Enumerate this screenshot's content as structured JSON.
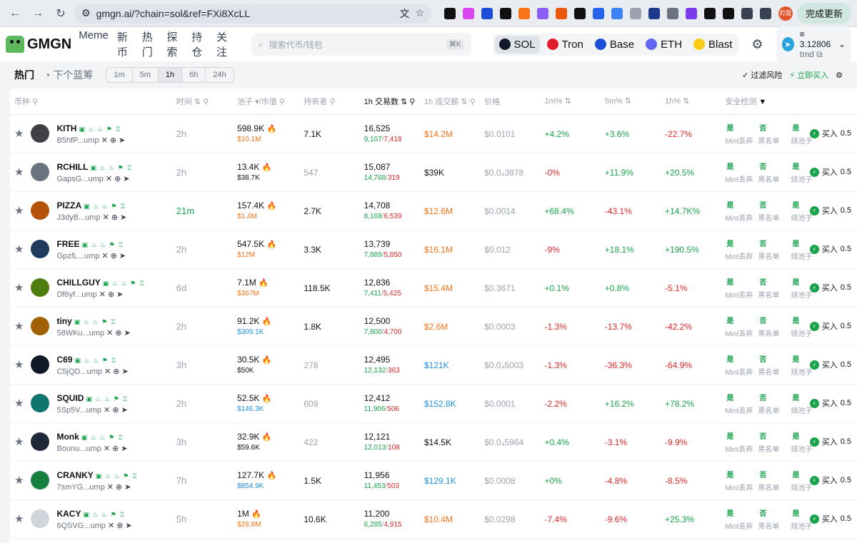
{
  "browser": {
    "url": "gmgn.ai/?chain=sol&ref=FXi8XcLL",
    "finish_update": "完成更新",
    "profile_badge": "盯盘"
  },
  "header": {
    "logo": "GMGN",
    "nav": [
      "Meme",
      "新币",
      "热门",
      "探索",
      "持仓",
      "关注"
    ],
    "search_placeholder": "搜索代币/钱包",
    "search_shortcut": "⌘K",
    "chains": [
      {
        "label": "SOL",
        "color": "#111827",
        "active": true
      },
      {
        "label": "Tron",
        "color": "#e11d2a",
        "active": false
      },
      {
        "label": "Base",
        "color": "#1d4ed8",
        "active": false
      },
      {
        "label": "ETH",
        "color": "#6366f1",
        "active": false
      },
      {
        "label": "Blast",
        "color": "#facc15",
        "active": false
      }
    ],
    "wallet_balance": "3.12806",
    "wallet_name": "tmd"
  },
  "filters": {
    "tab_hot": "热门",
    "tab_next": "下个蓝筹",
    "timeframes": [
      "1m",
      "5m",
      "1h",
      "6h",
      "24h"
    ],
    "active_timeframe": "1h",
    "filter_risk": "过滤风险",
    "buy_now": "立即买入"
  },
  "table": {
    "headers": {
      "coin": "币种",
      "time": "时间",
      "pool": "池子 ▾/市值",
      "holders": "持有者",
      "txs": "1h 交易数",
      "volume": "1h 成交额",
      "price": "价格",
      "m1": "1m%",
      "m5": "5m%",
      "h1": "1h%",
      "safety": "安全检测"
    },
    "safety_values": [
      "是",
      "否",
      "是"
    ],
    "safety_labels": [
      "Mint丢弃",
      "黑名单",
      "烧池子"
    ],
    "buy_label": "买入",
    "buy_amount": "0.5",
    "rows": [
      {
        "name": "KITH",
        "addr": "B5hfP...ump",
        "avatar": "#3f3f46",
        "time": "2h",
        "time_green": false,
        "pool": "598.9K",
        "mcap": "$10.1M",
        "mcap_color": "c-orange",
        "holders": "7.1K",
        "holders_grey": false,
        "txs": "16,525",
        "buys": "9,107",
        "sells": "7,418",
        "vol": "$14.2M",
        "vol_color": "c-orange",
        "price": "$0.0101",
        "m1": "+4.2%",
        "m5": "+3.6%",
        "h1": "-22.7%"
      },
      {
        "name": "RCHILL",
        "addr": "GapsG...ump",
        "avatar": "#6b7280",
        "time": "2h",
        "time_green": false,
        "pool": "13.4K",
        "mcap": "$38.7K",
        "mcap_color": "c-black",
        "holders": "547",
        "holders_grey": true,
        "txs": "15,087",
        "buys": "14,768",
        "sells": "319",
        "vol": "$39K",
        "vol_color": "c-black",
        "price": "$0.0₄3878",
        "m1": "-0%",
        "m5": "+11.9%",
        "h1": "+20.5%"
      },
      {
        "name": "PIZZA",
        "addr": "J3dyB...ump",
        "avatar": "#b45309",
        "time": "21m",
        "time_green": true,
        "pool": "157.4K",
        "mcap": "$1.4M",
        "mcap_color": "c-orange",
        "holders": "2.7K",
        "holders_grey": false,
        "txs": "14,708",
        "buys": "8,169",
        "sells": "6,539",
        "vol": "$12.6M",
        "vol_color": "c-orange",
        "price": "$0.0014",
        "m1": "+68.4%",
        "m5": "-43.1%",
        "h1": "+14.7K%"
      },
      {
        "name": "FREE",
        "addr": "GpzfL...ump",
        "avatar": "#1e3a5f",
        "time": "2h",
        "time_green": false,
        "pool": "547.5K",
        "mcap": "$12M",
        "mcap_color": "c-orange",
        "holders": "3.3K",
        "holders_grey": false,
        "txs": "13,739",
        "buys": "7,889",
        "sells": "5,850",
        "vol": "$16.1M",
        "vol_color": "c-orange",
        "price": "$0.012",
        "m1": "-9%",
        "m5": "+18.1%",
        "h1": "+190.5%"
      },
      {
        "name": "CHILLGUY",
        "addr": "Df6yf...ump",
        "avatar": "#4d7c0f",
        "time": "6d",
        "time_green": false,
        "pool": "7.1M",
        "mcap": "$367M",
        "mcap_color": "c-orange",
        "holders": "118.5K",
        "holders_grey": false,
        "txs": "12,836",
        "buys": "7,411",
        "sells": "5,425",
        "vol": "$15.4M",
        "vol_color": "c-orange",
        "price": "$0.3671",
        "m1": "+0.1%",
        "m5": "+0.8%",
        "h1": "-5.1%"
      },
      {
        "name": "tiny",
        "addr": "58WKu...ump",
        "avatar": "#a16207",
        "time": "2h",
        "time_green": false,
        "pool": "91.2K",
        "mcap": "$309.1K",
        "mcap_color": "c-blue",
        "holders": "1.8K",
        "holders_grey": false,
        "txs": "12,500",
        "buys": "7,800",
        "sells": "4,700",
        "vol": "$2.6M",
        "vol_color": "c-orange",
        "price": "$0.0003",
        "m1": "-1.3%",
        "m5": "-13.7%",
        "h1": "-42.2%"
      },
      {
        "name": "C69",
        "addr": "C5jQD...ump",
        "avatar": "#111827",
        "time": "3h",
        "time_green": false,
        "pool": "30.5K",
        "mcap": "$50K",
        "mcap_color": "c-black",
        "holders": "278",
        "holders_grey": true,
        "txs": "12,495",
        "buys": "12,132",
        "sells": "363",
        "vol": "$121K",
        "vol_color": "c-blue",
        "price": "$0.0₄5003",
        "m1": "-1.3%",
        "m5": "-36.3%",
        "h1": "-64.9%"
      },
      {
        "name": "SQUID",
        "addr": "5Sp5V...ump",
        "avatar": "#0f766e",
        "time": "2h",
        "time_green": false,
        "pool": "52.5K",
        "mcap": "$146.3K",
        "mcap_color": "c-blue",
        "holders": "609",
        "holders_grey": true,
        "txs": "12,412",
        "buys": "11,906",
        "sells": "506",
        "vol": "$152.8K",
        "vol_color": "c-blue",
        "price": "$0.0001",
        "m1": "-2.2%",
        "m5": "+16.2%",
        "h1": "+78.2%"
      },
      {
        "name": "Monk",
        "addr": "Bounu...ump",
        "avatar": "#1f2937",
        "time": "3h",
        "time_green": false,
        "pool": "32.9K",
        "mcap": "$59.6K",
        "mcap_color": "c-black",
        "holders": "422",
        "holders_grey": true,
        "txs": "12,121",
        "buys": "12,013",
        "sells": "108",
        "vol": "$14.5K",
        "vol_color": "c-black",
        "price": "$0.0₄5964",
        "m1": "+0.4%",
        "m5": "-3.1%",
        "h1": "-9.9%"
      },
      {
        "name": "CRANKY",
        "addr": "7smYG...ump",
        "avatar": "#15803d",
        "time": "7h",
        "time_green": false,
        "pool": "127.7K",
        "mcap": "$854.9K",
        "mcap_color": "c-blue",
        "holders": "1.5K",
        "holders_grey": false,
        "txs": "11,956",
        "buys": "11,453",
        "sells": "503",
        "vol": "$129.1K",
        "vol_color": "c-blue",
        "price": "$0.0008",
        "m1": "+0%",
        "m5": "-4.8%",
        "h1": "-8.5%"
      },
      {
        "name": "KACY",
        "addr": "6QSVG...ump",
        "avatar": "#d1d5db",
        "time": "5h",
        "time_green": false,
        "pool": "1M",
        "mcap": "$29.8M",
        "mcap_color": "c-orange",
        "holders": "10.6K",
        "holders_grey": false,
        "txs": "11,200",
        "buys": "6,285",
        "sells": "4,915",
        "vol": "$10.4M",
        "vol_color": "c-orange",
        "price": "$0.0298",
        "m1": "-7.4%",
        "m5": "-9.6%",
        "h1": "+25.3%"
      }
    ]
  }
}
